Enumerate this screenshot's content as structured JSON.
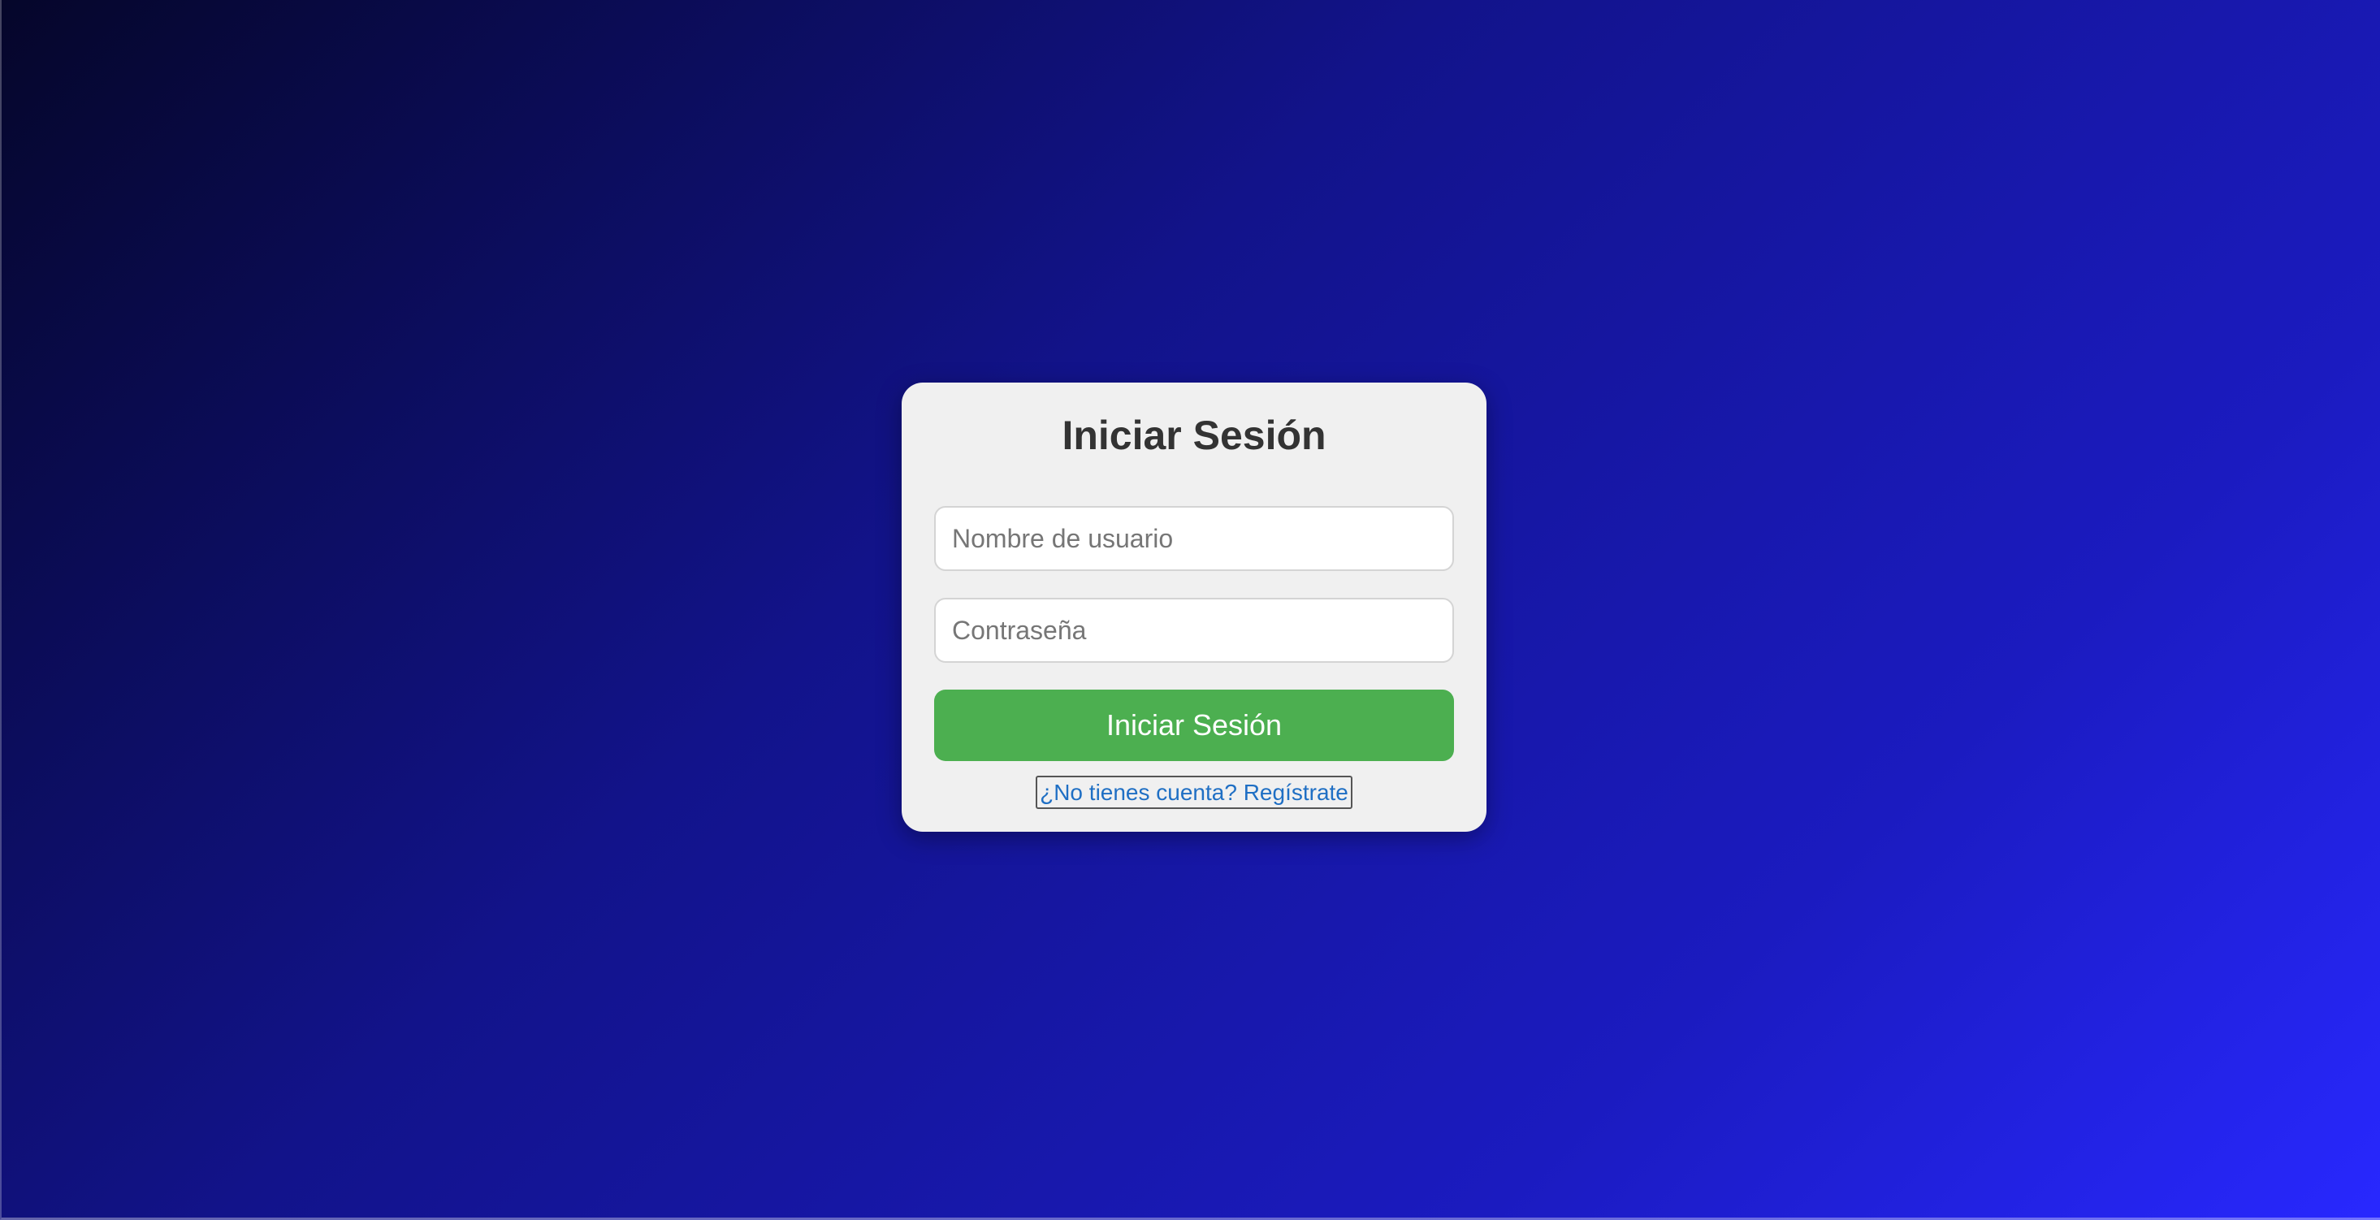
{
  "login": {
    "title": "Iniciar Sesión",
    "username_placeholder": "Nombre de usuario",
    "username_value": "",
    "password_placeholder": "Contraseña",
    "password_value": "",
    "submit_label": "Iniciar Sesión",
    "register_label": "¿No tienes cuenta? Regístrate"
  },
  "colors": {
    "background_start": "#05062a",
    "background_end": "#2828ff",
    "card_background": "#f0f0f0",
    "button_background": "#4caf50",
    "link_color": "#1f6fc4"
  }
}
